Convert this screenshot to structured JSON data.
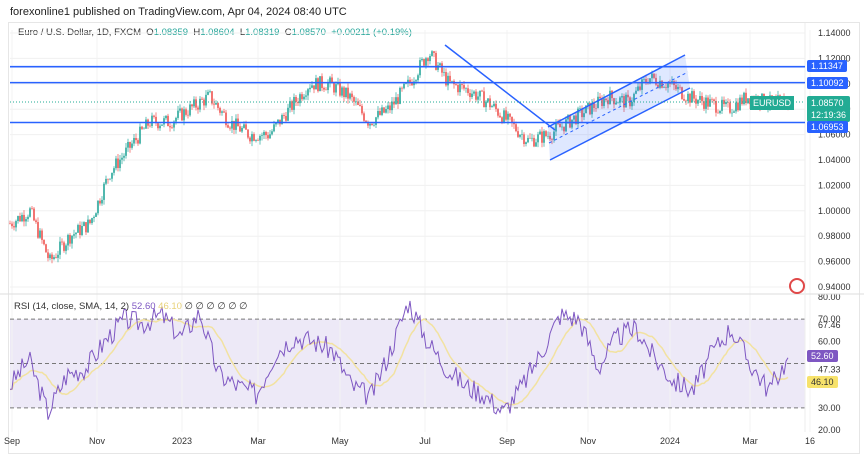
{
  "header": {
    "published": "forexonline1 published on TradingView.com, Apr 04, 2024 08:40 UTC"
  },
  "legend": {
    "title": "Euro / U.S. Dollar, 1D, FXCM",
    "o_label": "O",
    "o": "1.08359",
    "h_label": "H",
    "h": "1.08604",
    "l_label": "L",
    "l": "1.08319",
    "c_label": "C",
    "c": "1.08570",
    "change": "+0.00211 (+0.19%)"
  },
  "price_axis": [
    "1.14000",
    "1.12000",
    "1.10000",
    "1.08000",
    "1.06000",
    "1.04000",
    "1.02000",
    "1.00000",
    "0.98000",
    "0.96000",
    "0.94000"
  ],
  "levels": [
    "1.11347",
    "1.10092",
    "1.06953"
  ],
  "current": {
    "symbol": "EURUSD",
    "price": "1.08570",
    "countdown": "12:19:36"
  },
  "rsi": {
    "title": "RSI (14, close, SMA, 14, 2)",
    "value": "52.60",
    "sma": "46.10",
    "extra": "∅ ∅ ∅ ∅ ∅ ∅",
    "axis": [
      "80.00",
      "70.00",
      "67.46",
      "60.00",
      "47.33",
      "30.00",
      "20.00"
    ]
  },
  "time_axis": [
    "Sep",
    "Nov",
    "2023",
    "Mar",
    "May",
    "Jul",
    "Sep",
    "Nov",
    "2024",
    "Mar",
    "16"
  ],
  "colors": {
    "up": "#26a69a",
    "down": "#ef5350",
    "line": "#2962ff",
    "rsi": "#7e57c2",
    "sma": "#f2e2a0"
  },
  "chart_data": {
    "type": "candlestick",
    "price_path": [
      0.99,
      1.0,
      0.96,
      0.98,
      0.99,
      1.03,
      1.05,
      1.07,
      1.07,
      1.08,
      1.09,
      1.07,
      1.06,
      1.06,
      1.08,
      1.1,
      1.1,
      1.09,
      1.07,
      1.08,
      1.1,
      1.125,
      1.1,
      1.095,
      1.085,
      1.07,
      1.055,
      1.06,
      1.07,
      1.08,
      1.09,
      1.085,
      1.105,
      1.1,
      1.09,
      1.085,
      1.08,
      1.09,
      1.085,
      1.0857
    ],
    "rsi_path": [
      40,
      52,
      28,
      45,
      48,
      60,
      70,
      68,
      72,
      62,
      73,
      45,
      40,
      36,
      55,
      62,
      60,
      56,
      40,
      35,
      55,
      78,
      60,
      48,
      40,
      36,
      28,
      40,
      55,
      72,
      70,
      48,
      62,
      66,
      52,
      42,
      38,
      55,
      66,
      50,
      38,
      52.6
    ]
  }
}
